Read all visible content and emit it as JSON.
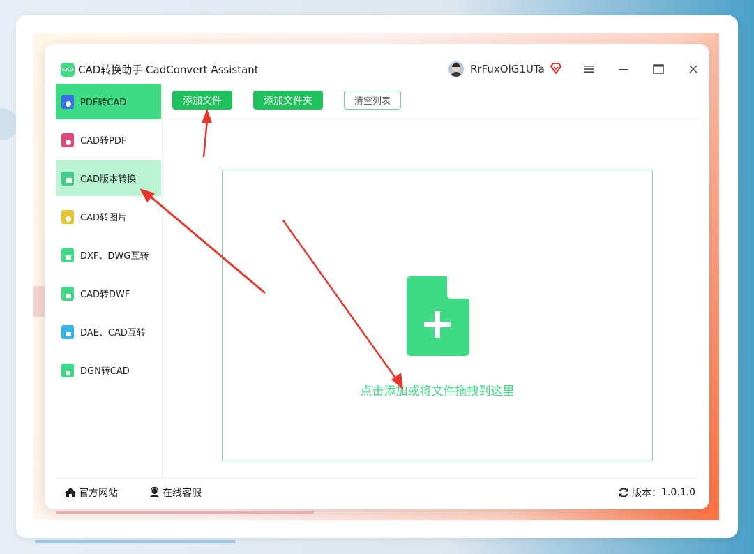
{
  "app": {
    "logo_text": "CAD",
    "title": "CAD转换助手 CadConvert Assistant",
    "username": "RrFuxOlG1UTa"
  },
  "sidebar": {
    "items": [
      {
        "label": "PDF转CAD",
        "state": "active"
      },
      {
        "label": "CAD转PDF",
        "state": "normal"
      },
      {
        "label": "CAD版本转换",
        "state": "hover"
      },
      {
        "label": "CAD转图片",
        "state": "normal"
      },
      {
        "label": "DXF、DWG互转",
        "state": "normal"
      },
      {
        "label": "CAD转DWF",
        "state": "normal"
      },
      {
        "label": "DAE、CAD互转",
        "state": "normal"
      },
      {
        "label": "DGN转CAD",
        "state": "normal"
      }
    ]
  },
  "toolbar": {
    "add_file": "添加文件",
    "add_folder": "添加文件夹",
    "clear_list": "清空列表"
  },
  "dropzone": {
    "hint": "点击添加或将文件拖拽到这里"
  },
  "footer": {
    "website": "官方网站",
    "support": "在线客服",
    "version_label": "版本：",
    "version": "1.0.1.0"
  },
  "colors": {
    "accent": "#3ddc84",
    "button": "#1fc15c",
    "hover": "#b9f3d3",
    "annotation_arrow": "#e8362a"
  },
  "icons": {
    "menu": "hamburger-icon",
    "minimize": "minimize-icon",
    "maximize": "maximize-icon",
    "close": "close-icon",
    "vip": "vip-diamond-icon",
    "home": "home-icon",
    "support": "headset-icon",
    "refresh": "refresh-icon",
    "add_file": "add-file-icon"
  }
}
